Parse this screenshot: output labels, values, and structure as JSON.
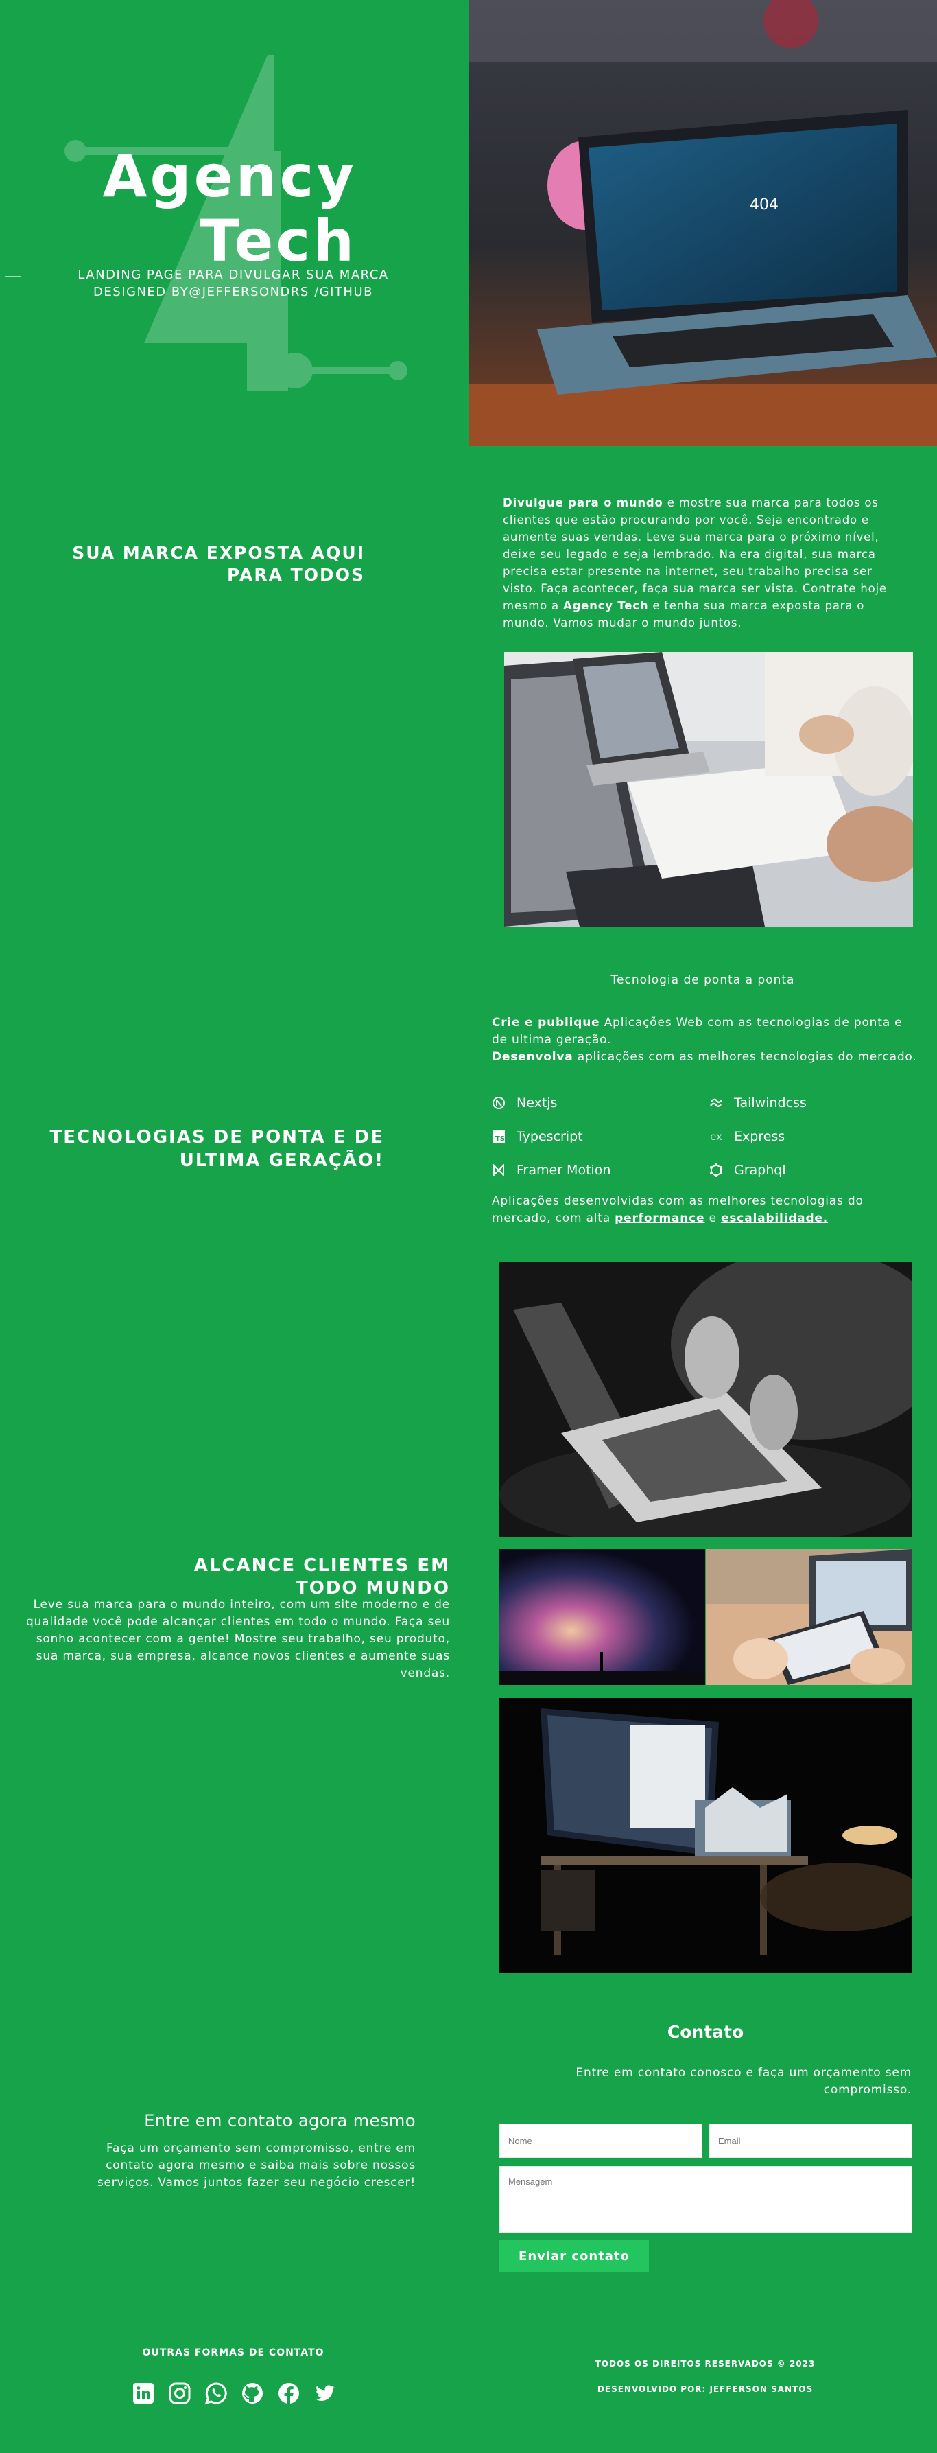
{
  "hero": {
    "title_line1": "Agency",
    "title_line2": "Tech",
    "subtitle_line1": "LANDING PAGE PARA DIVULGAR SUA MARCA",
    "subtitle_prefix": "DESIGNED BY",
    "author_link": "@JEFFERSONDRS",
    "separator": " /",
    "github_link": "GITHUB"
  },
  "section1": {
    "heading_line1": "SUA MARCA EXPOSTA AQUI",
    "heading_line2": "PARA TODOS",
    "p_bold1": "Divulgue para o mundo",
    "p_text1": " e mostre sua marca para todos os clientes que estão procurando por você. Seja encontrado e aumente suas vendas. Leve sua marca para o próximo nível, deixe seu legado e seja lembrado. Na era digital, sua marca precisa estar presente na internet, seu trabalho precisa ser visto. Faça acontecer, faça sua marca ser vista. Contrate hoje mesmo a ",
    "p_bold2": "Agency Tech",
    "p_text2": " e tenha sua marca exposta para o mundo. Vamos mudar o mundo juntos."
  },
  "section2": {
    "heading_line1": "TECNOLOGIAS DE PONTA E DE",
    "heading_line2": "ULTIMA GERAÇÃO!",
    "kicker": "Tecnologia de ponta a ponta",
    "line1_bold": "Crie e publique",
    "line1_text": " Aplicações Web com as tecnologias de ponta e de ultima geração.",
    "line2_bold": "Desenvolva",
    "line2_text": " aplicações com as melhores tecnologias do mercado.",
    "techs": [
      {
        "label": "Nextjs",
        "icon": "nextjs-icon"
      },
      {
        "label": "Tailwindcss",
        "icon": "tailwind-icon"
      },
      {
        "label": "Typescript",
        "icon": "typescript-icon"
      },
      {
        "label": "Express",
        "icon": "express-icon"
      },
      {
        "label": "Framer Motion",
        "icon": "framer-icon"
      },
      {
        "label": "Graphql",
        "icon": "graphql-icon"
      }
    ],
    "closing_text": "Aplicações desenvolvidas com as melhores tecnologias do mercado, com alta ",
    "closing_link1": "performance",
    "closing_and": " e ",
    "closing_link2": "escalabilidade."
  },
  "section3": {
    "heading_line1": "ALCANCE CLIENTES EM",
    "heading_line2": "TODO MUNDO",
    "text": "Leve sua marca para o mundo inteiro, com um site moderno e de qualidade você pode alcançar clientes em todo o mundo. Faça seu sonho acontecer com a gente! Mostre seu trabalho, seu produto, sua marca, sua empresa, alcance novos clientes e aumente suas vendas."
  },
  "contact": {
    "left_title": "Entre em contato agora mesmo",
    "left_text": "Faça um orçamento sem compromisso, entre em contato agora mesmo e saiba mais sobre nossos serviços. Vamos juntos fazer seu negócio crescer!",
    "title": "Contato",
    "subtitle": "Entre em contato conosco e faça um orçamento sem compromisso.",
    "name_placeholder": "Nome",
    "email_placeholder": "Email",
    "message_placeholder": "Mensagem",
    "submit_label": "Enviar contato"
  },
  "footer": {
    "other_contact": "OUTRAS FORMAS DE CONTATO",
    "rights": "TODOS OS DIREITOS RESERVADOS © 2023",
    "developed_by": "DESENVOLVIDO POR: JEFFERSON SANTOS",
    "socials": [
      "linkedin-icon",
      "instagram-icon",
      "whatsapp-icon",
      "github-icon",
      "facebook-icon",
      "twitter-icon"
    ]
  },
  "colors": {
    "background": "#16a34a",
    "button": "#22c55e",
    "text": "#ffffff"
  }
}
